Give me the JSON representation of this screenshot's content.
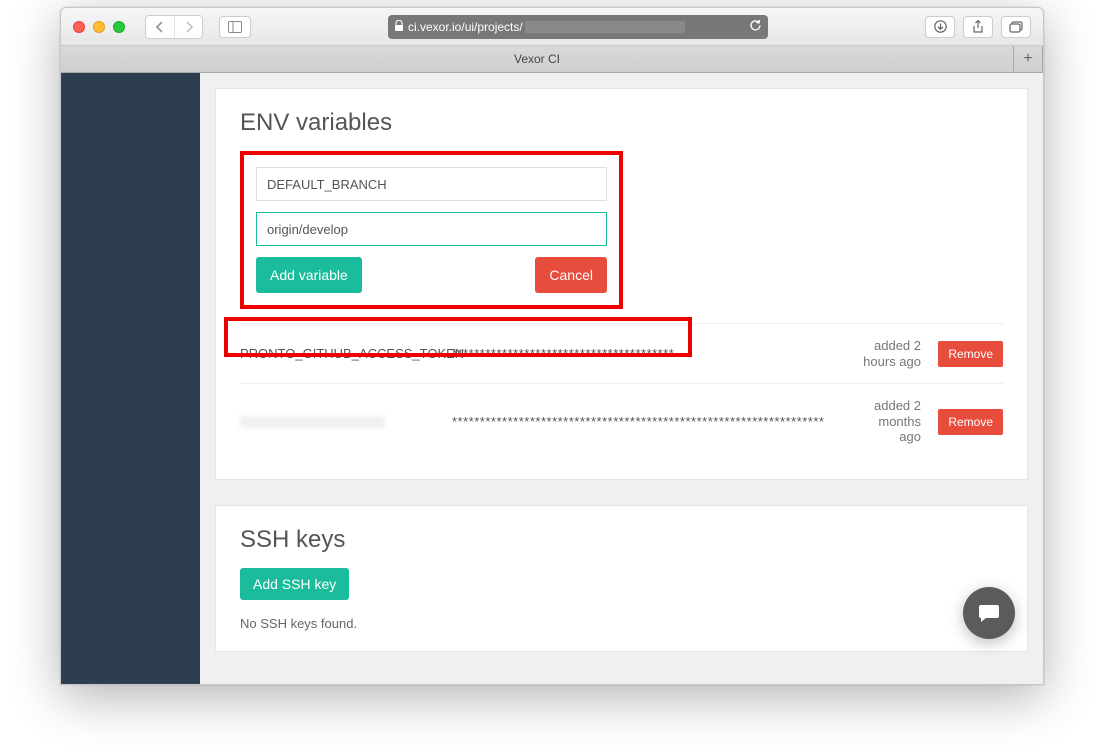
{
  "browser": {
    "url_prefix": "ci.vexor.io/ui/projects/",
    "tab_title": "Vexor CI"
  },
  "env_section": {
    "title": "ENV variables",
    "name_input_value": "DEFAULT_BRANCH",
    "value_input_value": "origin/develop",
    "add_label": "Add variable",
    "cancel_label": "Cancel"
  },
  "variables": [
    {
      "name": "PRONTO_GITHUB_ACCESS_TOKEN",
      "value": "****************************************",
      "time": "added 2 hours ago",
      "remove_label": "Remove"
    },
    {
      "name": "",
      "value": "*******************************************************************",
      "time": "added 2 months ago",
      "remove_label": "Remove"
    }
  ],
  "ssh_section": {
    "title": "SSH keys",
    "add_label": "Add SSH key",
    "empty_text": "No SSH keys found."
  }
}
